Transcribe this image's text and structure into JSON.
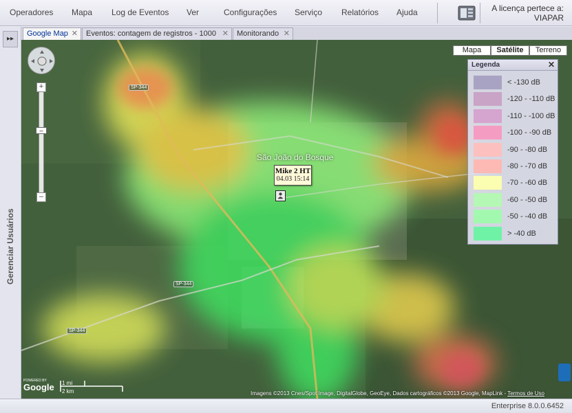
{
  "menu": {
    "items": [
      "Operadores",
      "Mapa",
      "Log de Eventos",
      "Ver",
      "Configurações",
      "Serviço",
      "Relatórios",
      "Ajuda"
    ],
    "license_line1": "A licença pertece a:",
    "license_line2": "VIAPAR"
  },
  "leftbar": {
    "label": "Gerenciar Usuários",
    "expand_glyph": "▸▸"
  },
  "tabs": [
    {
      "label": "Google Map",
      "active": true
    },
    {
      "label": "Eventos: contagem de registros - 1000",
      "active": false
    },
    {
      "label": "Monitorando",
      "active": false
    }
  ],
  "map": {
    "types": [
      {
        "label": "Mapa",
        "active": false
      },
      {
        "label": "Satélite",
        "active": true
      },
      {
        "label": "Terreno",
        "active": false
      }
    ],
    "place_name": "São João do Bosque",
    "road_labels": [
      "SP-344",
      "SP-344",
      "SP-344"
    ],
    "marker": {
      "title": "Mike 2 HT",
      "time": "04.03 15:14"
    },
    "scale": {
      "mi": "1 mi",
      "km": "2 km"
    },
    "logo": "Google",
    "powered": "POWERED BY",
    "attribution": "Imagens ©2013 Cnes/Spot Image, DigitalGlobe, GeoEye, Dados cartográficos ©2013 Google, MapLink -",
    "terms": "Termos de Uso"
  },
  "legend": {
    "title": "Legenda",
    "close": "✕",
    "rows": [
      {
        "label": "< -130 dB",
        "color": "#a9a3c3"
      },
      {
        "label": "-120 - -110 dB",
        "color": "#c9a4c6"
      },
      {
        "label": "-110 - -100 dB",
        "color": "#d5a4cf"
      },
      {
        "label": "-100 - -90 dB",
        "color": "#f59cc2"
      },
      {
        "label": "-90 - -80 dB",
        "color": "#fcc0bf"
      },
      {
        "label": "-80 - -70 dB",
        "color": "#fdb9b4"
      },
      {
        "label": "-70 - -60 dB",
        "color": "#fbfdb0"
      },
      {
        "label": "-60 - -50 dB",
        "color": "#b5f7b4"
      },
      {
        "label": "-50 - -40 dB",
        "color": "#a3f8b0"
      },
      {
        "label": "> -40 dB",
        "color": "#6ff2a6"
      }
    ]
  },
  "status": {
    "version": "Enterprise 8.0.0.6452"
  }
}
